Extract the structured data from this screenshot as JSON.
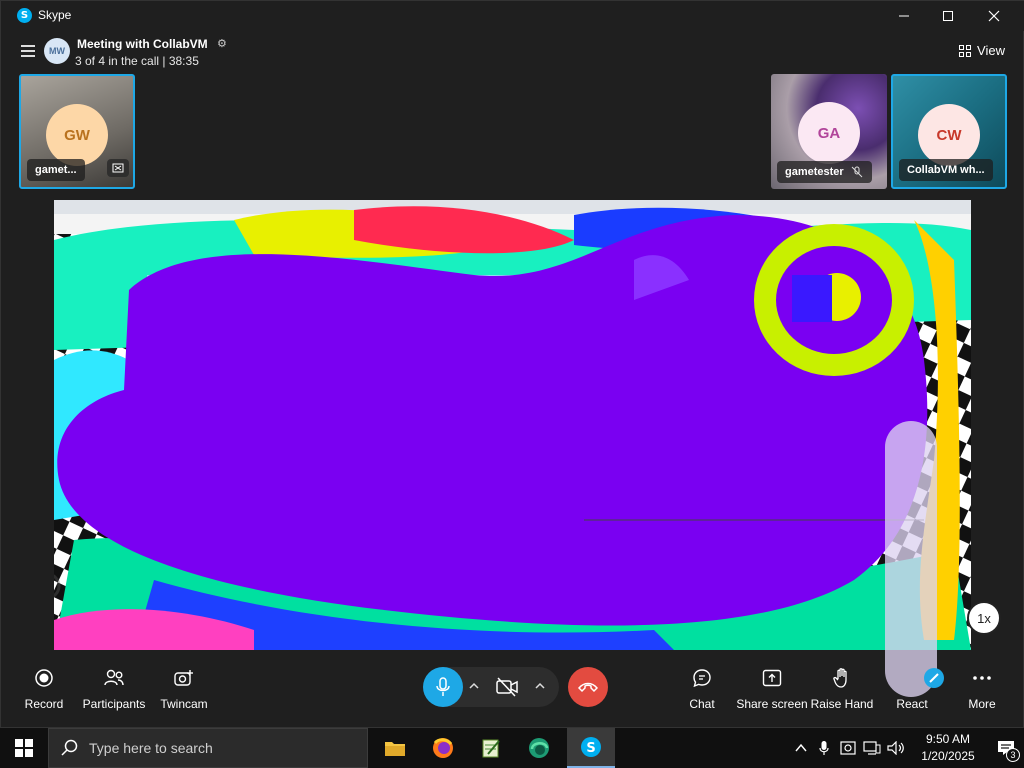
{
  "window": {
    "title": "Skype"
  },
  "header": {
    "avatar_initials": "MW",
    "meeting_title": "Meeting with CollabVM",
    "call_status": "3 of 4 in the call | 38:35",
    "view_label": "View"
  },
  "participants": [
    {
      "initials": "GW",
      "name": "gamet...",
      "avatar_bg": "#fdd7a7",
      "avatar_fg": "#b9721f",
      "active": true
    },
    {
      "initials": "GA",
      "name": "gametester",
      "avatar_bg": "#fbe8f3",
      "avatar_fg": "#b1459a",
      "active": false
    },
    {
      "initials": "CW",
      "name": "CollabVM wh...",
      "avatar_bg": "#fde6e4",
      "avatar_fg": "#c8392b",
      "active": true
    }
  ],
  "shared_screen": {
    "zoom": "1x"
  },
  "toolbar": {
    "record": "Record",
    "participants": "Participants",
    "twincam": "Twincam",
    "chat": "Chat",
    "share_screen": "Share screen",
    "raise_hand": "Raise Hand",
    "react": "React",
    "more": "More"
  },
  "taskbar": {
    "search_placeholder": "Type here to search",
    "time": "9:50 AM",
    "date": "1/20/2025",
    "notification_count": "3"
  },
  "colors": {
    "accent": "#1ea8e6",
    "end_call": "#e34b40",
    "background": "#1f1f1f"
  }
}
